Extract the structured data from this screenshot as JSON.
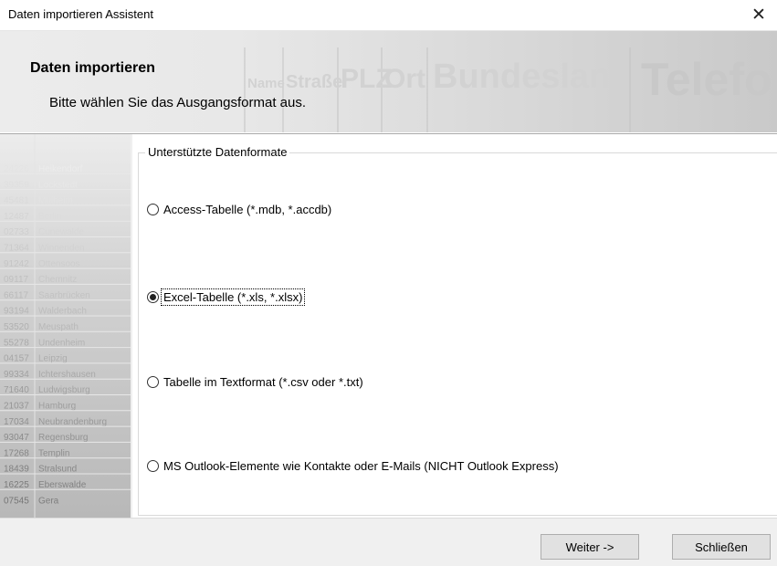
{
  "window": {
    "title": "Daten importieren Assistent",
    "close_glyph": "✕"
  },
  "banner": {
    "heading": "Daten importieren",
    "subheading": "Bitte wählen Sie das Ausgangsformat aus.",
    "watermark_words": [
      "Name",
      "Straße",
      "PLZ",
      "Ort",
      "Bundesland",
      "Telefo"
    ]
  },
  "sidebar": {
    "rows": [
      {
        "plz": "24226",
        "name": "Heikendorf"
      },
      {
        "plz": "39359",
        "name": "Lockstedt"
      },
      {
        "plz": "45481",
        "name": "Mülheim"
      },
      {
        "plz": "12487",
        "name": "Berlin"
      },
      {
        "plz": "02733",
        "name": "Cunewalde"
      },
      {
        "plz": "71364",
        "name": "Winnenden"
      },
      {
        "plz": "91242",
        "name": "Ottensoos"
      },
      {
        "plz": "09117",
        "name": "Chemnitz"
      },
      {
        "plz": "66117",
        "name": "Saarbrücken"
      },
      {
        "plz": "93194",
        "name": "Walderbach"
      },
      {
        "plz": "53520",
        "name": "Meuspath"
      },
      {
        "plz": "55278",
        "name": "Undenheim"
      },
      {
        "plz": "04157",
        "name": "Leipzig"
      },
      {
        "plz": "99334",
        "name": "Ichtershausen"
      },
      {
        "plz": "71640",
        "name": "Ludwigsburg"
      },
      {
        "plz": "21037",
        "name": "Hamburg"
      },
      {
        "plz": "17034",
        "name": "Neubrandenburg"
      },
      {
        "plz": "93047",
        "name": "Regensburg"
      },
      {
        "plz": "17268",
        "name": "Templin"
      },
      {
        "plz": "18439",
        "name": "Stralsund"
      },
      {
        "plz": "16225",
        "name": "Eberswalde"
      },
      {
        "plz": "07545",
        "name": "Gera"
      }
    ]
  },
  "group": {
    "legend": "Unterstützte Datenformate",
    "options": [
      {
        "label": "Access-Tabelle (*.mdb, *.accdb)",
        "selected": false
      },
      {
        "label": "Excel-Tabelle (*.xls, *.xlsx)",
        "selected": true
      },
      {
        "label": "Tabelle im Textformat (*.csv oder *.txt)",
        "selected": false
      },
      {
        "label": "MS Outlook-Elemente wie Kontakte oder E-Mails (NICHT Outlook Express)",
        "selected": false
      }
    ]
  },
  "footer": {
    "next_label": "Weiter ->",
    "close_label": "Schließen"
  }
}
